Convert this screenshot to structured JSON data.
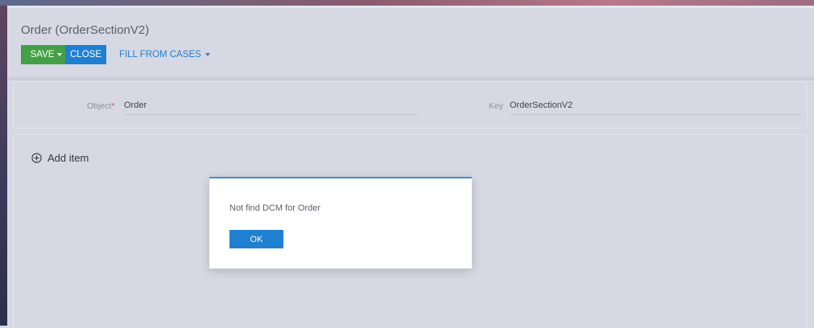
{
  "page": {
    "title": "Order (OrderSectionV2)"
  },
  "toolbar": {
    "save_label": "SAVE",
    "close_label": "CLOSE",
    "fill_label": "FILL FROM CASES"
  },
  "form": {
    "object_label": "Object",
    "object_required_mark": "*",
    "object_value": "Order",
    "key_label": "Key",
    "key_value": "OrderSectionV2"
  },
  "items": {
    "add_label": "Add item"
  },
  "dialog": {
    "message": "Not find DCM for Order",
    "ok_label": "OK"
  },
  "colors": {
    "save_green": "#43a047",
    "primary_blue": "#1f7fd1",
    "background": "#d6d9e3"
  },
  "icons": {
    "add": "plus-circle-icon",
    "dropdown": "caret-down-icon"
  }
}
